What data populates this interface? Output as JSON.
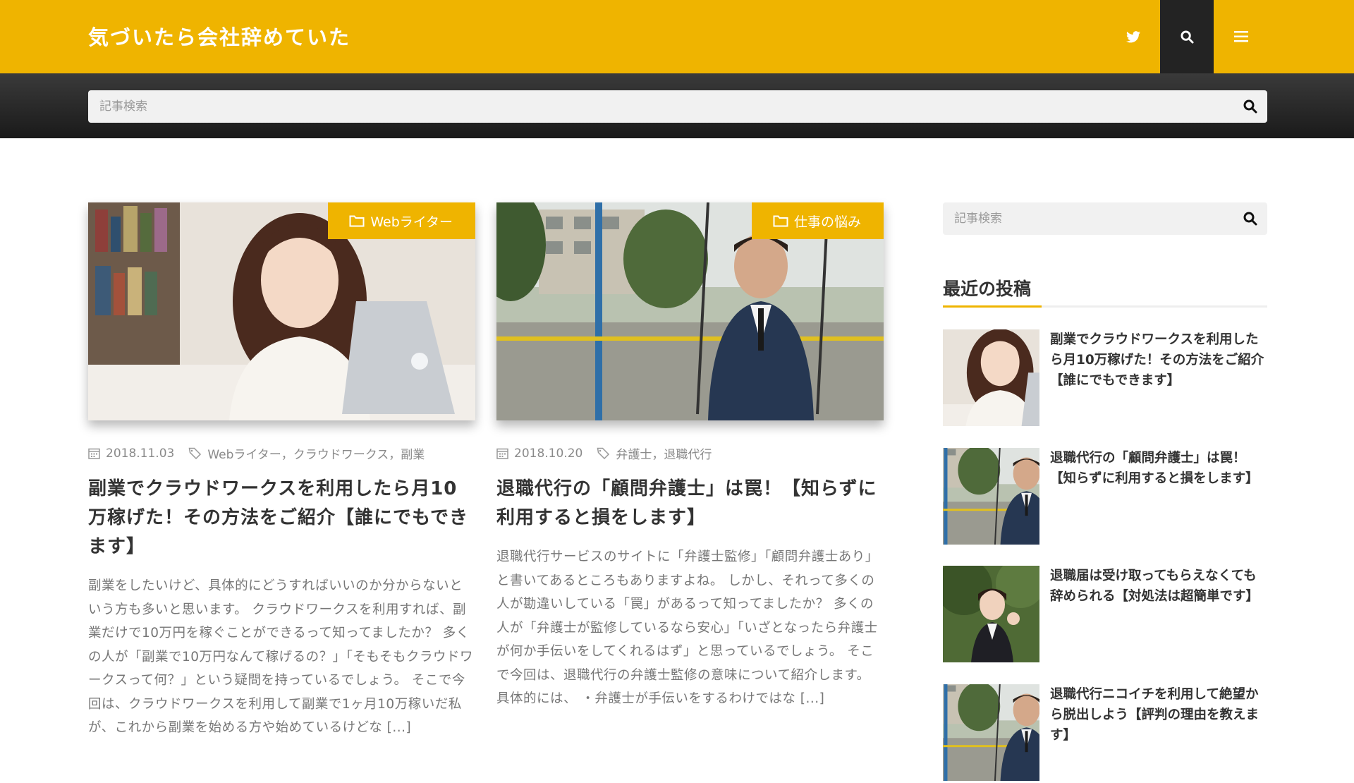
{
  "header": {
    "site_title": "気づいたら会社辞めていた",
    "icons": [
      "twitter-icon",
      "search-icon",
      "menu-icon"
    ],
    "brand_color": "#efb400",
    "dark_color": "#232323"
  },
  "search": {
    "placeholder": "記事検索"
  },
  "posts": [
    {
      "category": "Webライター",
      "date": "2018.11.03",
      "tags": "Webライター，クラウドワークス，副業",
      "title": "副業でクラウドワークスを利用したら月10万稼げた！その方法をご紹介【誰にでもできます】",
      "excerpt": "副業をしたいけど、具体的にどうすればいいのか分からないという方も多いと思います。 クラウドワークスを利用すれば、副業だけで10万円を稼ぐことができるって知ってましたか？ 多くの人が「副業で10万円なんて稼げるの？」「そもそもクラウドワークスって何？」という疑問を持っているでしょう。 そこで今回は、クラウドワークスを利用して副業で1ヶ月10万稼いだ私が、これから副業を始める方や始めているけどな [...]"
    },
    {
      "category": "仕事の悩み",
      "date": "2018.10.20",
      "tags": "弁護士，退職代行",
      "title": "退職代行の「顧問弁護士」は罠！【知らずに利用すると損をします】",
      "excerpt": "退職代行サービスのサイトに「弁護士監修」「顧問弁護士あり」と書いてあるところもありますよね。 しかし、それって多くの人が勘違いしている「罠」があるって知ってましたか？ 多くの人が「弁護士が監修しているなら安心」「いざとなったら弁護士が何か手伝いをしてくれるはず」と思っているでしょう。 そこで今回は、退職代行の弁護士監修の意味について紹介します。 具体的には、 ・弁護士が手伝いをするわけではな [...]"
    }
  ],
  "sidebar": {
    "search_placeholder": "記事検索",
    "widget_title": "最近の投稿",
    "recent": [
      {
        "title": "副業でクラウドワークスを利用したら月10万稼げた！その方法をご紹介【誰にでもできます】"
      },
      {
        "title": "退職代行の「顧問弁護士」は罠！【知らずに利用すると損をします】"
      },
      {
        "title": "退職届は受け取ってもらえなくても辞められる【対処法は超簡単です】"
      },
      {
        "title": "退職代行ニコイチを利用して絶望から脱出しよう【評判の理由を教えます】"
      }
    ]
  }
}
